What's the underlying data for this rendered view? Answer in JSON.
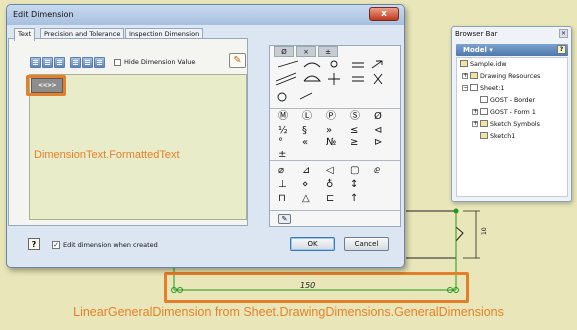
{
  "dialog": {
    "title": "Edit Dimension",
    "close_glyph": "x",
    "tabs": [
      {
        "label": "Text"
      },
      {
        "label": "Precision and Tolerance"
      },
      {
        "label": "Inspection Dimension"
      }
    ],
    "hide_dimension_value": {
      "label": "Hide Dimension Value",
      "checked": false
    },
    "text_token": "<<>>",
    "edit_when_created": {
      "label": "Edit dimension when created",
      "checked": true,
      "check_glyph": "✓"
    },
    "ok_label": "OK",
    "cancel_label": "Cancel",
    "help_glyph": "?",
    "pencil_icon": "pencil-icon"
  },
  "palette": {
    "tab_symbols": [
      "Ø",
      "×",
      "±"
    ],
    "symbols": [
      "Ⓜ",
      "Ⓛ",
      "Ⓟ",
      "Ⓢ",
      "Ø",
      "½",
      "§",
      "»",
      "≤",
      "⊲",
      "°",
      "«",
      "№",
      "≥",
      "⊳",
      "±",
      "⌀",
      "⊿",
      "◁",
      "▢",
      "ⅇ",
      "⊥",
      "⋄",
      "♁",
      "↕",
      "⊓",
      "△",
      "⊏",
      "↑"
    ]
  },
  "annotations": {
    "formatted_text": "DimensionText.FormattedText",
    "linear_dimension": "LinearGeneralDimension from Sheet.DrawingDimensions.GeneralDimensions"
  },
  "drawing": {
    "horizontal_value": "150",
    "vertical_value": "10"
  },
  "browser_bar": {
    "title": "Browser Bar",
    "pin_glyph": "×",
    "model_label": "Model ▾",
    "help_glyph": "?",
    "items": [
      {
        "label": "Sample.idw"
      },
      {
        "label": "Drawing Resources"
      },
      {
        "label": "Sheet:1"
      },
      {
        "label": "GOST - Border"
      },
      {
        "label": "GOST - Form 1"
      },
      {
        "label": "Sketch Symbols"
      },
      {
        "label": "Sketch1"
      }
    ]
  },
  "colors": {
    "annotation": "#e5802a",
    "dim_line": "#1e9a1e"
  }
}
